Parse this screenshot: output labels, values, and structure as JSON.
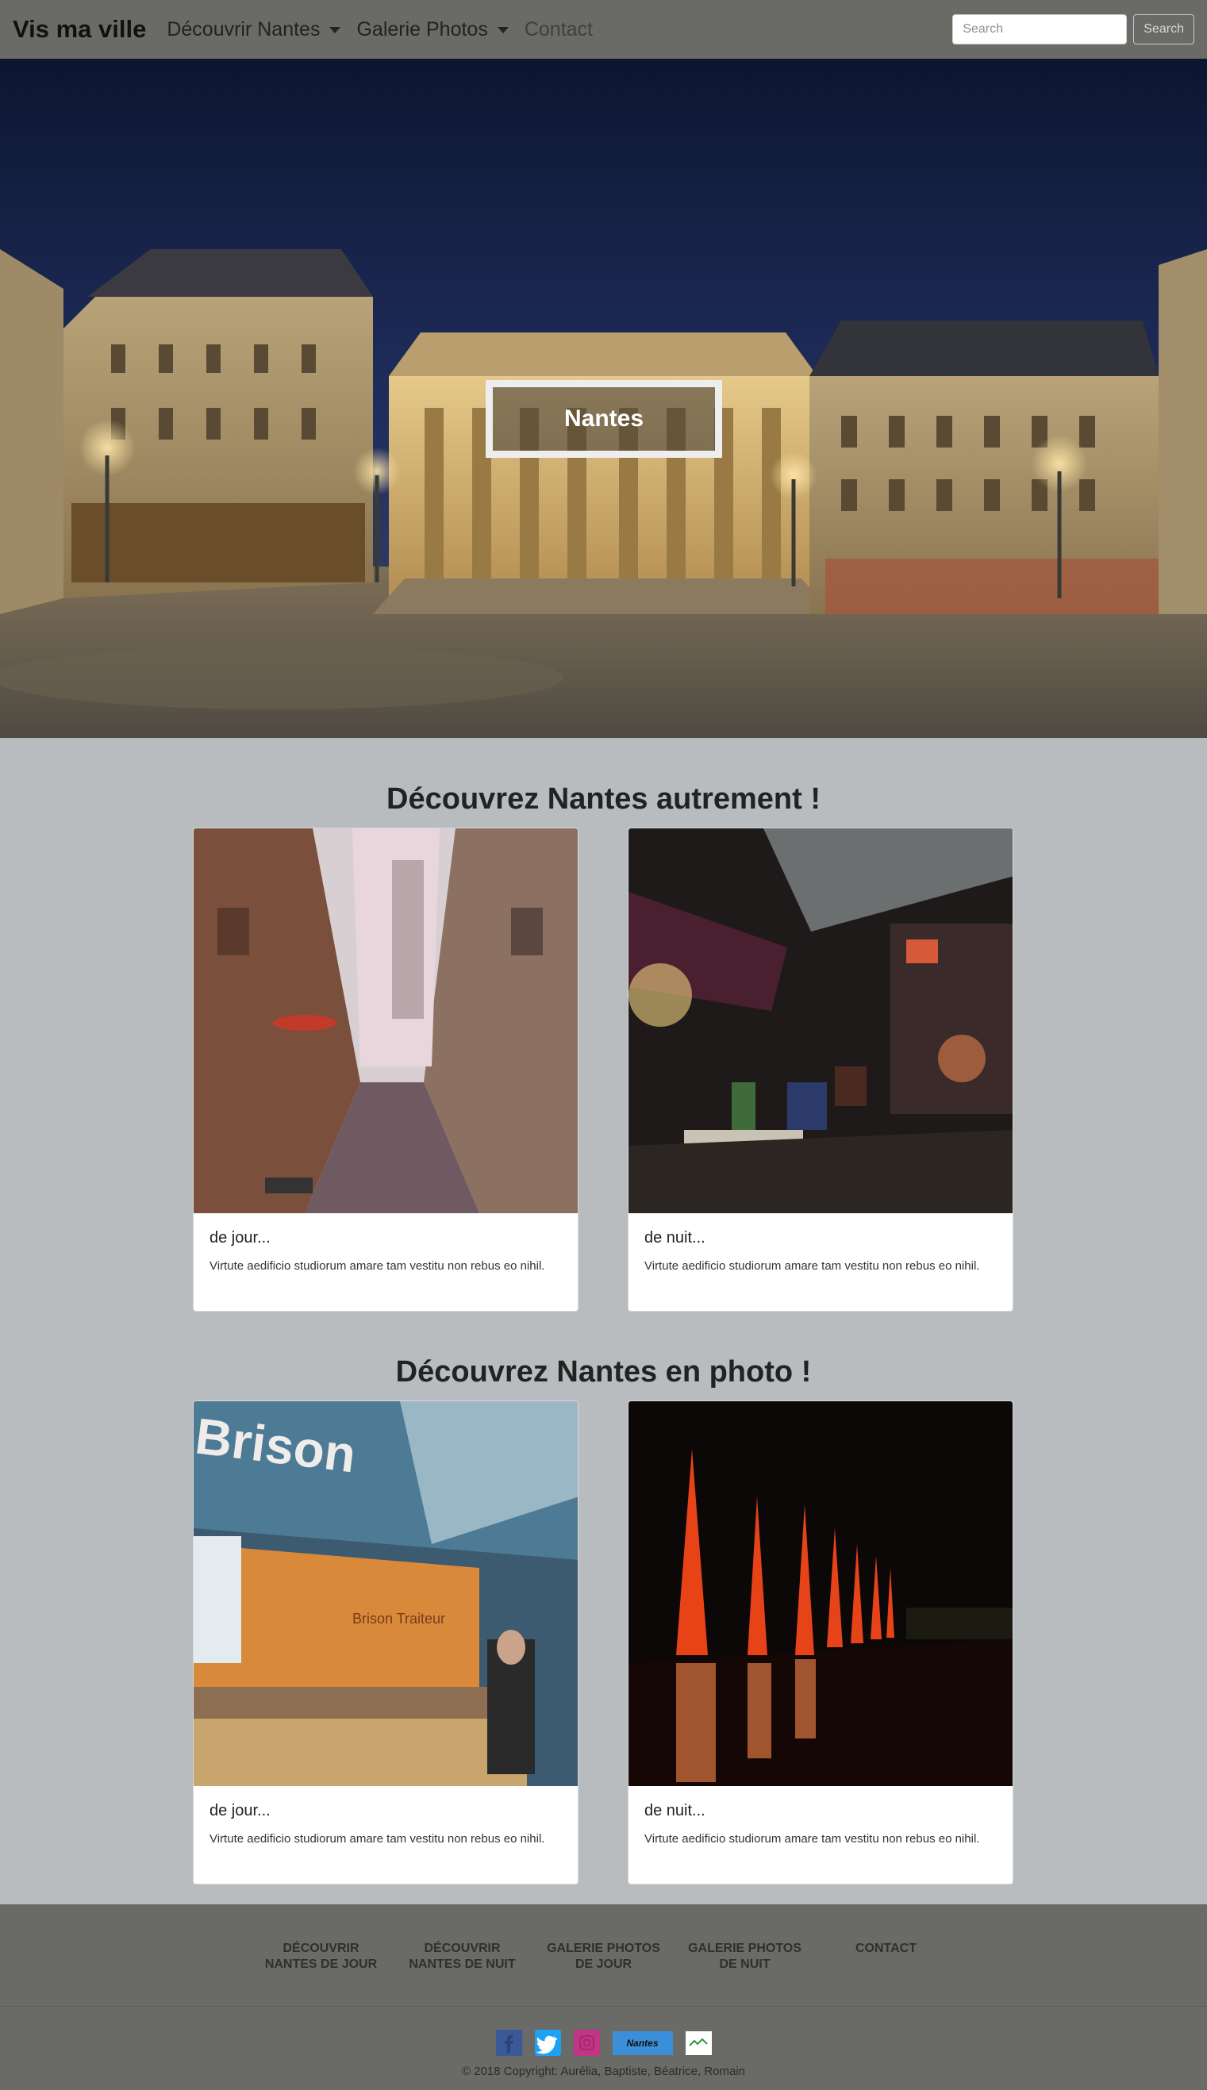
{
  "navbar": {
    "brand": "Vis ma ville",
    "items": [
      {
        "label": "Découvrir Nantes",
        "dropdown": true
      },
      {
        "label": "Galerie Photos",
        "dropdown": true
      },
      {
        "label": "Contact",
        "dropdown": false
      }
    ],
    "search_placeholder": "Search",
    "search_button": "Search"
  },
  "hero": {
    "title": "Nantes"
  },
  "section1": {
    "title": "Découvrez Nantes autrement !",
    "cards": [
      {
        "title": "de jour...",
        "text": "Virtute aedificio studiorum amare tam vestitu non rebus eo nihil."
      },
      {
        "title": "de nuit...",
        "text": "Virtute aedificio studiorum amare tam vestitu non rebus eo nihil."
      }
    ]
  },
  "section2": {
    "title": "Découvrez Nantes en photo !",
    "cards": [
      {
        "title": "de jour...",
        "text": "Virtute aedificio studiorum amare tam vestitu non rebus eo nihil.",
        "sign": "Brison",
        "sign2": "Brison Traiteur"
      },
      {
        "title": "de nuit...",
        "text": "Virtute aedificio studiorum amare tam vestitu non rebus eo nihil."
      }
    ]
  },
  "footer": {
    "links": [
      {
        "line1": "DÉCOUVRIR",
        "line2": "NANTES DE JOUR"
      },
      {
        "line1": "DÉCOUVRIR",
        "line2": "NANTES DE NUIT"
      },
      {
        "line1": "GALERIE PHOTOS",
        "line2": "DE JOUR"
      },
      {
        "line1": "GALERIE PHOTOS",
        "line2": "DE NUIT"
      },
      {
        "line1": "CONTACT",
        "line2": ""
      }
    ],
    "socials": [
      "facebook-icon",
      "twitter-icon",
      "instagram-icon",
      "nantes-logo",
      "partner-logo"
    ],
    "nantes_logo_text": "Nantes",
    "copyright": "© 2018 Copyright: Aurélia, Baptiste, Béatrice, Romain"
  },
  "colors": {
    "navbar_bg": "#6a6a67",
    "page_bg": "#b8bcbe",
    "card_bg": "#ffffff",
    "facebook": "#3b5998",
    "twitter": "#1da1f2",
    "instagram": "#c13584",
    "nantes_blue": "#3a8fd8"
  }
}
